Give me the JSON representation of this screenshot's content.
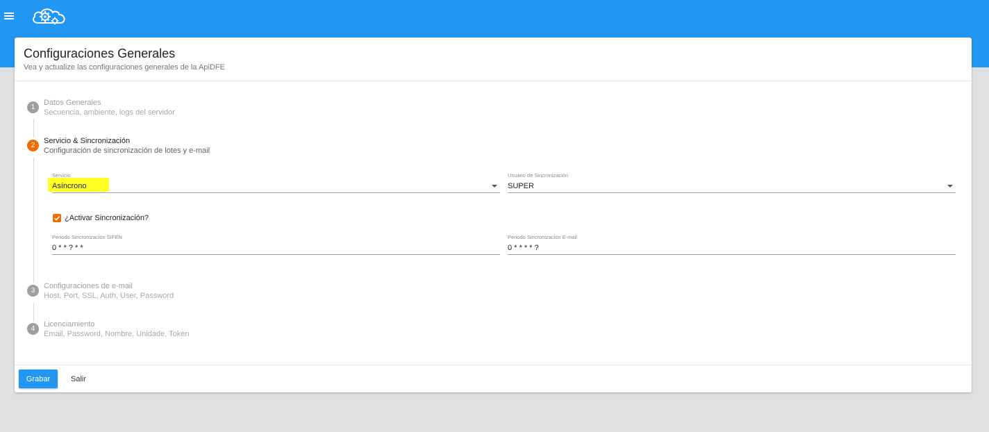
{
  "header": {
    "menu_icon": "menu-icon",
    "logo_icon": "cloud-gears-logo",
    "bar_color": "#2196f3"
  },
  "page": {
    "title": "Configuraciones Generales",
    "subtitle": "Vea y actualize las configuraciones generales de la ApiDFE"
  },
  "steps": [
    {
      "number": "1",
      "title": "Datos Generales",
      "subtitle": "Secuencia, ambiente, logs del servidor",
      "state": "inactive"
    },
    {
      "number": "2",
      "title": "Servicio & Sincronización",
      "subtitle": "Configuración de sincronización de lotes y e-mail",
      "state": "active"
    },
    {
      "number": "3",
      "title": "Configuraciones de e-mail",
      "subtitle": "Host, Port, SSL, Auth, User, Password",
      "state": "inactive"
    },
    {
      "number": "4",
      "title": "Licenciamiento",
      "subtitle": "Email, Password, Nombre, Unidade, Token",
      "state": "inactive"
    }
  ],
  "form": {
    "servicio": {
      "label": "Servicio",
      "value": "Asíncrono"
    },
    "usuario": {
      "label": "Usuario de Sincronización",
      "value": "SUPER"
    },
    "activar": {
      "label": "¿Activar Sincronización?",
      "checked": true
    },
    "periodo_sifen": {
      "label": "Periodo Sincronización SIFEN",
      "value": "0 * * ? * *"
    },
    "periodo_email": {
      "label": "Periodo Sincronización E-mail",
      "value": "0 * * * * ?"
    }
  },
  "actions": {
    "save_label": "Grabar",
    "exit_label": "Salir"
  },
  "colors": {
    "primary": "#2196f3",
    "accent": "#ef6c00",
    "highlight": "#ffff26"
  }
}
